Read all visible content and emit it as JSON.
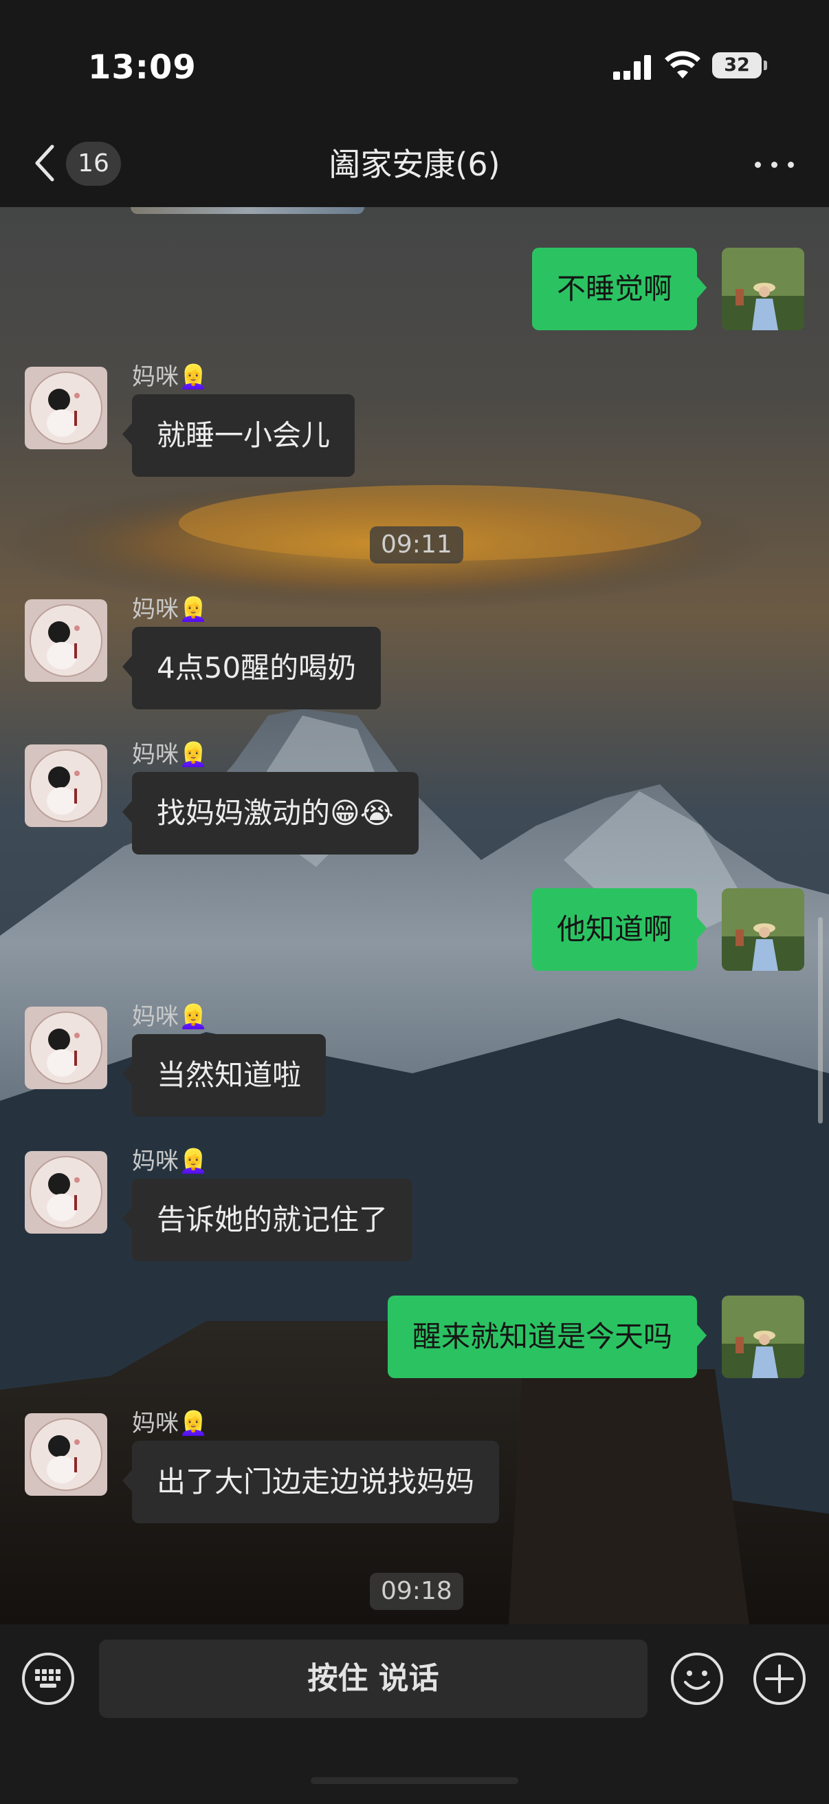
{
  "status_bar": {
    "time": "13:09",
    "battery": "32",
    "icons": [
      "cellular-signal-icon",
      "wifi-icon",
      "battery-icon"
    ]
  },
  "nav": {
    "back_icon": "chevron-left-icon",
    "unread_count": "16",
    "title": "阖家安康(6)",
    "more_icon": "more-dots-icon"
  },
  "messages": [
    {
      "kind": "out",
      "text": "不睡觉啊"
    },
    {
      "kind": "in",
      "sender": "妈咪👱‍♀️",
      "text": "就睡一小会儿"
    },
    {
      "kind": "time",
      "text": "09:11"
    },
    {
      "kind": "in",
      "sender": "妈咪👱‍♀️",
      "text": "4点50醒的喝奶"
    },
    {
      "kind": "in",
      "sender": "妈咪👱‍♀️",
      "text": "找妈妈激动的😁😭"
    },
    {
      "kind": "out",
      "text": "他知道啊"
    },
    {
      "kind": "in",
      "sender": "妈咪👱‍♀️",
      "text": "当然知道啦"
    },
    {
      "kind": "in",
      "sender": "妈咪👱‍♀️",
      "text": "告诉她的就记住了"
    },
    {
      "kind": "out",
      "text": "醒来就知道是今天吗"
    },
    {
      "kind": "in",
      "sender": "妈咪👱‍♀️",
      "text": "出了大门边走边说找妈妈"
    },
    {
      "kind": "time",
      "text": "09:18"
    }
  ],
  "input_bar": {
    "voice_keyboard_icon": "keyboard-icon",
    "hold_to_talk_label": "按住 说话",
    "emoji_icon": "smiley-face-icon",
    "add_icon": "plus-circle-icon"
  },
  "colors": {
    "outgoing_bubble": "#2bc362",
    "incoming_bubble": "#2c2c2c",
    "bar_background": "#181818"
  }
}
